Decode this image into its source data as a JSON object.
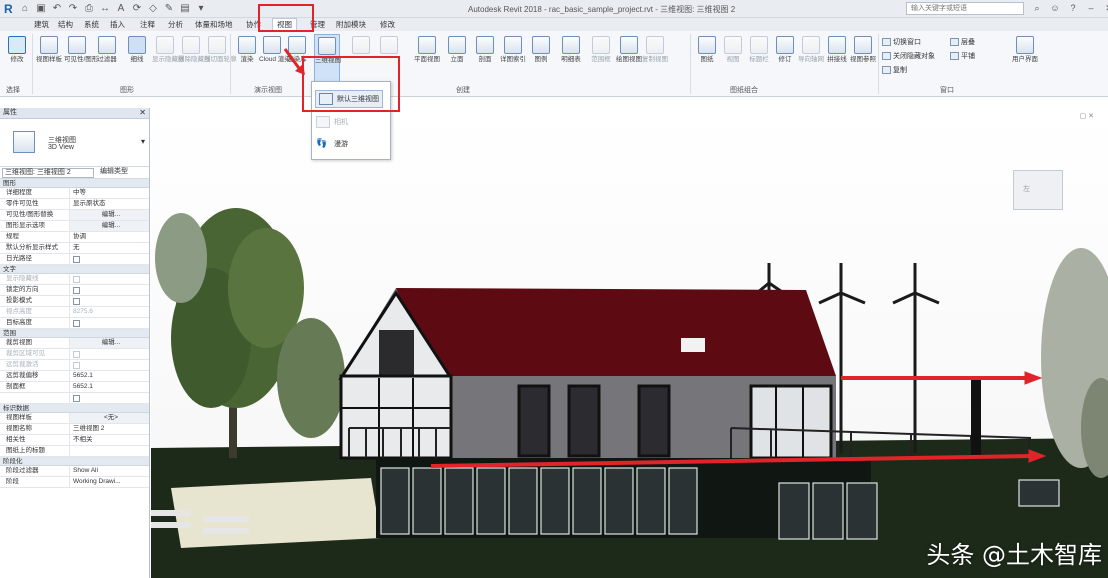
{
  "titlebar": {
    "app_logo": "R",
    "title": "Autodesk Revit 2018  -  rac_basic_sample_project.rvt - 三维视图: 三维视图 2",
    "search_placeholder": "输入关键字或短语"
  },
  "tabs": [
    "建筑",
    "结构",
    "系统",
    "插入",
    "注释",
    "分析",
    "体量和场地",
    "协作",
    "视图",
    "管理",
    "附加模块",
    "修改"
  ],
  "active_tab": "视图",
  "ribbon": {
    "modify": "修改",
    "select": "选择",
    "graphics_group": "图形",
    "graphics_buttons": [
      "视图样板",
      "可见性/图形",
      "过滤器",
      "细线",
      "显示隐藏线",
      "删除隐藏线",
      "剖切面轮廓"
    ],
    "presentation_group": "演示视图",
    "presentation_buttons": [
      "渲染",
      "Cloud 渲染",
      "渲染库"
    ],
    "three_d_view": "三维视图",
    "create_group": "创建",
    "create_buttons": [
      "平面视图",
      "立面",
      "剖面",
      "详图索引",
      "图例",
      "明细表",
      "范围框",
      "绘图视图",
      "复制视图"
    ],
    "sheet_group": "图纸组合",
    "sheet_buttons": [
      "图纸",
      "视图",
      "标题栏",
      "修订",
      "导向轴网",
      "拼接线",
      "视图参照",
      "视口"
    ],
    "windows_group": "窗口",
    "window_buttons": [
      "切换窗口",
      "关闭隐藏对象",
      "复制",
      "层叠",
      "平铺",
      "用户界面"
    ]
  },
  "dropdown": {
    "items": [
      {
        "label": "默认三维视图",
        "enabled": true
      },
      {
        "label": "相机",
        "enabled": false
      },
      {
        "label": "漫游",
        "enabled": true
      }
    ]
  },
  "properties": {
    "title": "属性",
    "type_name_line1": "三维视图",
    "type_name_line2": "3D View",
    "view_selector": "三维视图: 三维视图 2",
    "edit_type": "编辑类型",
    "sections": [
      {
        "name": "图形",
        "rows": [
          {
            "key": "详细程度",
            "value": "中等",
            "kind": "text"
          },
          {
            "key": "零件可见性",
            "value": "显示原状态",
            "kind": "text"
          },
          {
            "key": "可见性/图形替换",
            "value": "编辑...",
            "kind": "button"
          },
          {
            "key": "图形显示选项",
            "value": "编辑...",
            "kind": "button"
          },
          {
            "key": "规程",
            "value": "协调",
            "kind": "text"
          },
          {
            "key": "默认分析显示样式",
            "value": "无",
            "kind": "text"
          },
          {
            "key": "日光路径",
            "value": "",
            "kind": "check"
          }
        ]
      },
      {
        "name": "文字",
        "rows": [
          {
            "key": "显示隐藏线",
            "value": "",
            "kind": "check-dim"
          },
          {
            "key": "锁定的方向",
            "value": "",
            "kind": "check"
          },
          {
            "key": "投影模式",
            "value": "",
            "kind": "check"
          },
          {
            "key": "视点高度",
            "value": "8275.6",
            "kind": "dim"
          },
          {
            "key": "目标高度",
            "value": "",
            "kind": "check"
          }
        ]
      },
      {
        "name": "范围",
        "rows": [
          {
            "key": "裁剪视图",
            "value": "编辑...",
            "kind": "button"
          },
          {
            "key": "裁剪区域可见",
            "value": "",
            "kind": "check-dim"
          },
          {
            "key": "远剪裁激活",
            "value": "",
            "kind": "check-dim"
          },
          {
            "key": "远剪裁偏移",
            "value": "5652.1",
            "kind": "text"
          },
          {
            "key": "剖面框",
            "value": "5652.1",
            "kind": "text"
          },
          {
            "key": "",
            "value": "",
            "kind": "check"
          }
        ]
      },
      {
        "name": "标识数据",
        "rows": [
          {
            "key": "视图样板",
            "value": "<无>",
            "kind": "button"
          },
          {
            "key": "视图名称",
            "value": "三维视图 2",
            "kind": "text"
          },
          {
            "key": "相关性",
            "value": "不相关",
            "kind": "text"
          },
          {
            "key": "图纸上的标题",
            "value": "",
            "kind": "text"
          }
        ]
      },
      {
        "name": "阶段化",
        "rows": [
          {
            "key": "阶段过滤器",
            "value": "Show All",
            "kind": "text"
          },
          {
            "key": "阶段",
            "value": "Working Drawi...",
            "kind": "text"
          }
        ]
      }
    ]
  },
  "viewport": {
    "viewcube_label": "左",
    "watermark": "头条 @土木智库"
  },
  "colors": {
    "roof": "#5e0a12",
    "annotation_red": "#e0242a",
    "wall": "#76767a"
  }
}
